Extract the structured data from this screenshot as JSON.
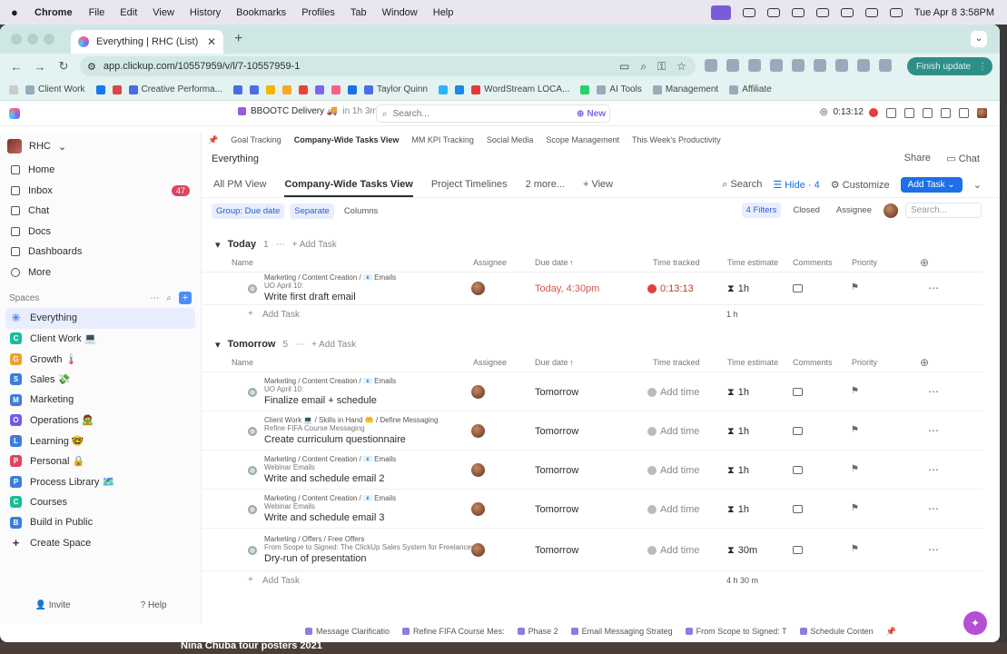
{
  "mac": {
    "app": "Chrome",
    "menus": [
      "File",
      "Edit",
      "View",
      "History",
      "Bookmarks",
      "Profiles",
      "Tab",
      "Window",
      "Help"
    ],
    "clock": "Tue Apr 8  3:58PM"
  },
  "browser": {
    "tab_title": "Everything | RHC (List)",
    "url": "app.clickup.com/10557959/v/l/7-10557959-1",
    "finish_update": "Finish update",
    "bookmarks": [
      "Client Work",
      "Creative Performa...",
      "Taylor Quinn",
      "WordStream LOCA...",
      "AI Tools",
      "Management",
      "Affiliate"
    ]
  },
  "topbar": {
    "pinned": "BBOOTC Delivery 🚚",
    "pinned_time": "in 1h 3m",
    "search_placeholder": "Search...",
    "new_label": "New",
    "timer": "0:13:12"
  },
  "sidebar": {
    "workspace": "RHC",
    "nav": [
      {
        "label": "Home"
      },
      {
        "label": "Inbox",
        "badge": "47"
      },
      {
        "label": "Chat"
      },
      {
        "label": "Docs"
      },
      {
        "label": "Dashboards"
      },
      {
        "label": "More"
      }
    ],
    "spaces_label": "Spaces",
    "spaces": [
      {
        "label": "Everything",
        "color": "#4f8ef7",
        "letter": "✳"
      },
      {
        "label": "Client Work 💻",
        "color": "#1bbc9c",
        "letter": "C"
      },
      {
        "label": "Growth 🌡️",
        "color": "#f0a030",
        "letter": "G"
      },
      {
        "label": "Sales 💸",
        "color": "#3b7ddd",
        "letter": "S"
      },
      {
        "label": "Marketing",
        "color": "#3b7ddd",
        "letter": "M"
      },
      {
        "label": "Operations 🧟",
        "color": "#6b5ce7",
        "letter": "O"
      },
      {
        "label": "Learning 🤓",
        "color": "#3b7ddd",
        "letter": "L"
      },
      {
        "label": "Personal 🔒",
        "color": "#e0435f",
        "letter": "P"
      },
      {
        "label": "Process Library 🗺️",
        "color": "#3b7ddd",
        "letter": "P"
      },
      {
        "label": "Courses",
        "color": "#1bbc9c",
        "letter": "C"
      },
      {
        "label": "Build in Public",
        "color": "#3b7ddd",
        "letter": "B"
      },
      {
        "label": "Create Space",
        "color": "#ffffff",
        "letter": "+"
      }
    ],
    "invite": "Invite",
    "help": "Help"
  },
  "views_strip": [
    "Goal Tracking",
    "Company-Wide Tasks View",
    "MM KPI Tracking",
    "Social Media",
    "Scope Management",
    "This Week's Productivity"
  ],
  "page": {
    "title": "Everything",
    "share": "Share",
    "chat": "Chat",
    "tabs": [
      "All PM View",
      "Company-Wide Tasks View",
      "Project Timelines",
      "2 more...",
      "View"
    ],
    "actions": {
      "search": "Search",
      "hide": "Hide · 4",
      "customize": "Customize",
      "add_task": "Add Task"
    },
    "filters": {
      "group": "Group: Due date",
      "separate": "Separate",
      "columns": "Columns",
      "filters": "4 Filters",
      "closed": "Closed",
      "assignee": "Assignee",
      "search_placeholder": "Search..."
    }
  },
  "columns": [
    "Name",
    "Assignee",
    "Due date",
    "Time tracked",
    "Time estimate",
    "Comments",
    "Priority"
  ],
  "groups": [
    {
      "name": "Today",
      "count": "1",
      "add": "Add Task",
      "total": "1 h",
      "tasks": [
        {
          "crumbs": "Marketing  /  Content Creation  /  📧 Emails",
          "parent": "UO April 10:",
          "title": "Write first draft email",
          "due": "Today, 4:30pm",
          "due_color": "#d9534f",
          "tracked": "0:13:13",
          "tracking": true,
          "estimate": "1h"
        }
      ]
    },
    {
      "name": "Tomorrow",
      "count": "5",
      "add": "Add Task",
      "total": "4 h 30 m",
      "tasks": [
        {
          "crumbs": "Marketing  /  Content Creation  /  📧 Emails",
          "parent": "UO April 10:",
          "title": "Finalize email + schedule",
          "due": "Tomorrow",
          "tracked": "Add time",
          "estimate": "1h"
        },
        {
          "crumbs": "Client Work 💻  /  Skills in Hand 🤲  /  Define Messaging",
          "parent": "Refine FIFA Course Messaging",
          "title": "Create curriculum questionnaire",
          "due": "Tomorrow",
          "tracked": "Add time",
          "estimate": "1h"
        },
        {
          "crumbs": "Marketing  /  Content Creation  /  📧 Emails",
          "parent": "Webinar Emails",
          "title": "Write and schedule email 2",
          "due": "Tomorrow",
          "tracked": "Add time",
          "estimate": "1h"
        },
        {
          "crumbs": "Marketing  /  Content Creation  /  📧 Emails",
          "parent": "Webinar Emails",
          "title": "Write and schedule email 3",
          "due": "Tomorrow",
          "tracked": "Add time",
          "estimate": "1h"
        },
        {
          "crumbs": "Marketing  /  Offers  /  Free Offers",
          "parent": "From Scope to Signed: The ClickUp Sales System for Freelancers",
          "title": "Dry-run of presentation",
          "due": "Tomorrow",
          "tracked": "Add time",
          "estimate": "30m"
        }
      ]
    }
  ],
  "bottom_tabs": [
    "Message Clarificatio",
    "Refine FIFA Course Mes:",
    "Phase 2",
    "Email Messaging Strateg",
    "From Scope to Signed: T",
    "Schedule Conten"
  ],
  "desktop_text": "Nina Chuba tour posters 2021"
}
